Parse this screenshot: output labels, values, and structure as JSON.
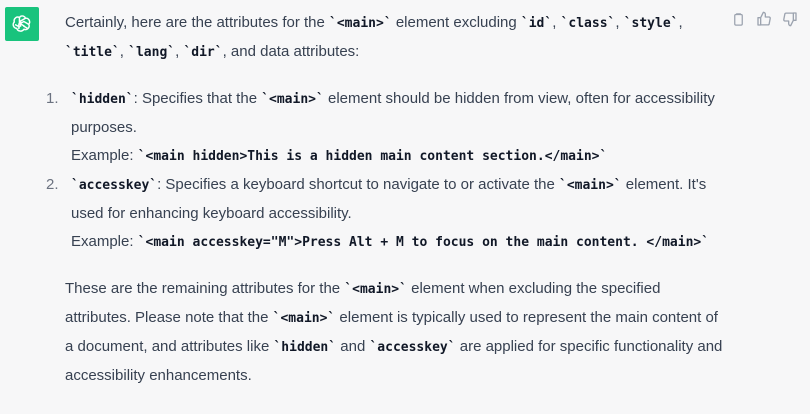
{
  "message": {
    "intro_pre": "Certainly, here are the attributes for the ",
    "intro_main": "`<main>`",
    "intro_mid": " element excluding ",
    "excl_id": "`id`",
    "sep1": ", ",
    "excl_class": "`class`",
    "sep2": ", ",
    "excl_style": "`style`",
    "sep3": ",",
    "excl_title": "`title`",
    "sep4": ", ",
    "excl_lang": "`lang`",
    "sep5": ", ",
    "excl_dir": "`dir`",
    "intro_end": ", and data attributes:",
    "items": [
      {
        "number": "1.",
        "attr": "`hidden`",
        "desc_pre": ": Specifies that the ",
        "desc_code": "`<main>`",
        "desc_post": " element should be hidden from view, often for accessibility purposes.",
        "example_label": "Example: ",
        "example_code": "`<main hidden>This is a hidden main content section.</main>`"
      },
      {
        "number": "2.",
        "attr": "`accesskey`",
        "desc_pre": ": Specifies a keyboard shortcut to navigate to or activate the ",
        "desc_code": "`<main>`",
        "desc_post": " element. It's used for enhancing keyboard accessibility.",
        "example_label": "Example: ",
        "example_code": "`<main accesskey=\"M\">Press Alt + M to focus on the main content. </main>`"
      }
    ],
    "closing_pre": "These are the remaining attributes for the ",
    "closing_main1": "`<main>`",
    "closing_mid1": " element when excluding the specified attributes. Please note that the ",
    "closing_main2": "`<main>`",
    "closing_mid2": " element is typically used to represent the main content of a document, and attributes like ",
    "closing_hidden": "`hidden`",
    "closing_and": " and ",
    "closing_accesskey": "`accesskey`",
    "closing_end": " are applied for specific functionality and accessibility enhancements."
  },
  "icons": {
    "avatar": "openai-logo-icon",
    "copy": "clipboard-icon",
    "like": "thumbs-up-icon",
    "dislike": "thumbs-down-icon"
  },
  "colors": {
    "avatar_bg": "#19c37d",
    "background": "#f7f7f8",
    "text": "#374151"
  }
}
